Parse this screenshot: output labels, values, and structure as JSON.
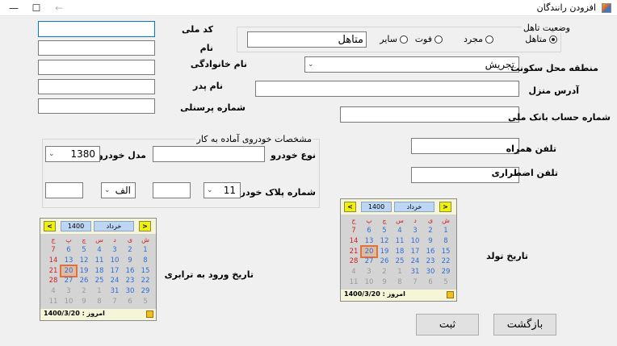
{
  "window": {
    "title": "افزودن رانندگان"
  },
  "labels": {
    "code_melli": "کد ملی",
    "name": "نام",
    "family": "نام خانوادگی",
    "father": "نام پدر",
    "personnel": "شماره پرسنلی",
    "marital_group": "وضعیت تاهل",
    "region": "منطقه محل سکونت",
    "address": "آدرس منزل",
    "bank_account": "شماره حساب بانک ملی",
    "mobile": "تلفن همراه",
    "emergency": "تلفن اضطراری",
    "vehicle_group": "مشخصات خودروی آماده به کار",
    "vehicle_type": "نوع خودرو",
    "vehicle_model": "مدل خودرو",
    "plate": "شماره پلاک خودرو",
    "birth_date": "تاریخ تولد",
    "entry_date": "تاریخ ورود به ترابری"
  },
  "marital": {
    "options": [
      "متاهل",
      "مجرد",
      "فوت",
      "سایر"
    ],
    "selected": "متاهل",
    "value": "متاهل"
  },
  "region": {
    "selected": "تجریش"
  },
  "vehicle": {
    "model_selected": "1380"
  },
  "plate": {
    "number_selected": "11",
    "letter_selected": "الف"
  },
  "buttons": {
    "save": "ثبت",
    "back": "بازگشت"
  },
  "calendar": {
    "year": "1400",
    "month": "خرداد",
    "prev": "<",
    "next": ">",
    "weekdays": [
      "ش",
      "ی",
      "د",
      "س",
      "چ",
      "پ",
      "ج"
    ],
    "rows": [
      [
        "1",
        "2",
        "3",
        "4",
        "5",
        "6",
        "7"
      ],
      [
        "8",
        "9",
        "10",
        "11",
        "12",
        "13",
        "14"
      ],
      [
        "15",
        "16",
        "17",
        "18",
        "19",
        "20",
        "21"
      ],
      [
        "22",
        "23",
        "24",
        "25",
        "26",
        "27",
        "28"
      ],
      [
        "29",
        "30",
        "31",
        "1",
        "2",
        "3",
        "4"
      ],
      [
        "5",
        "6",
        "7",
        "8",
        "9",
        "10",
        "11"
      ]
    ],
    "selected_day": "20",
    "today_label": "امروز : 1400/3/20"
  }
}
